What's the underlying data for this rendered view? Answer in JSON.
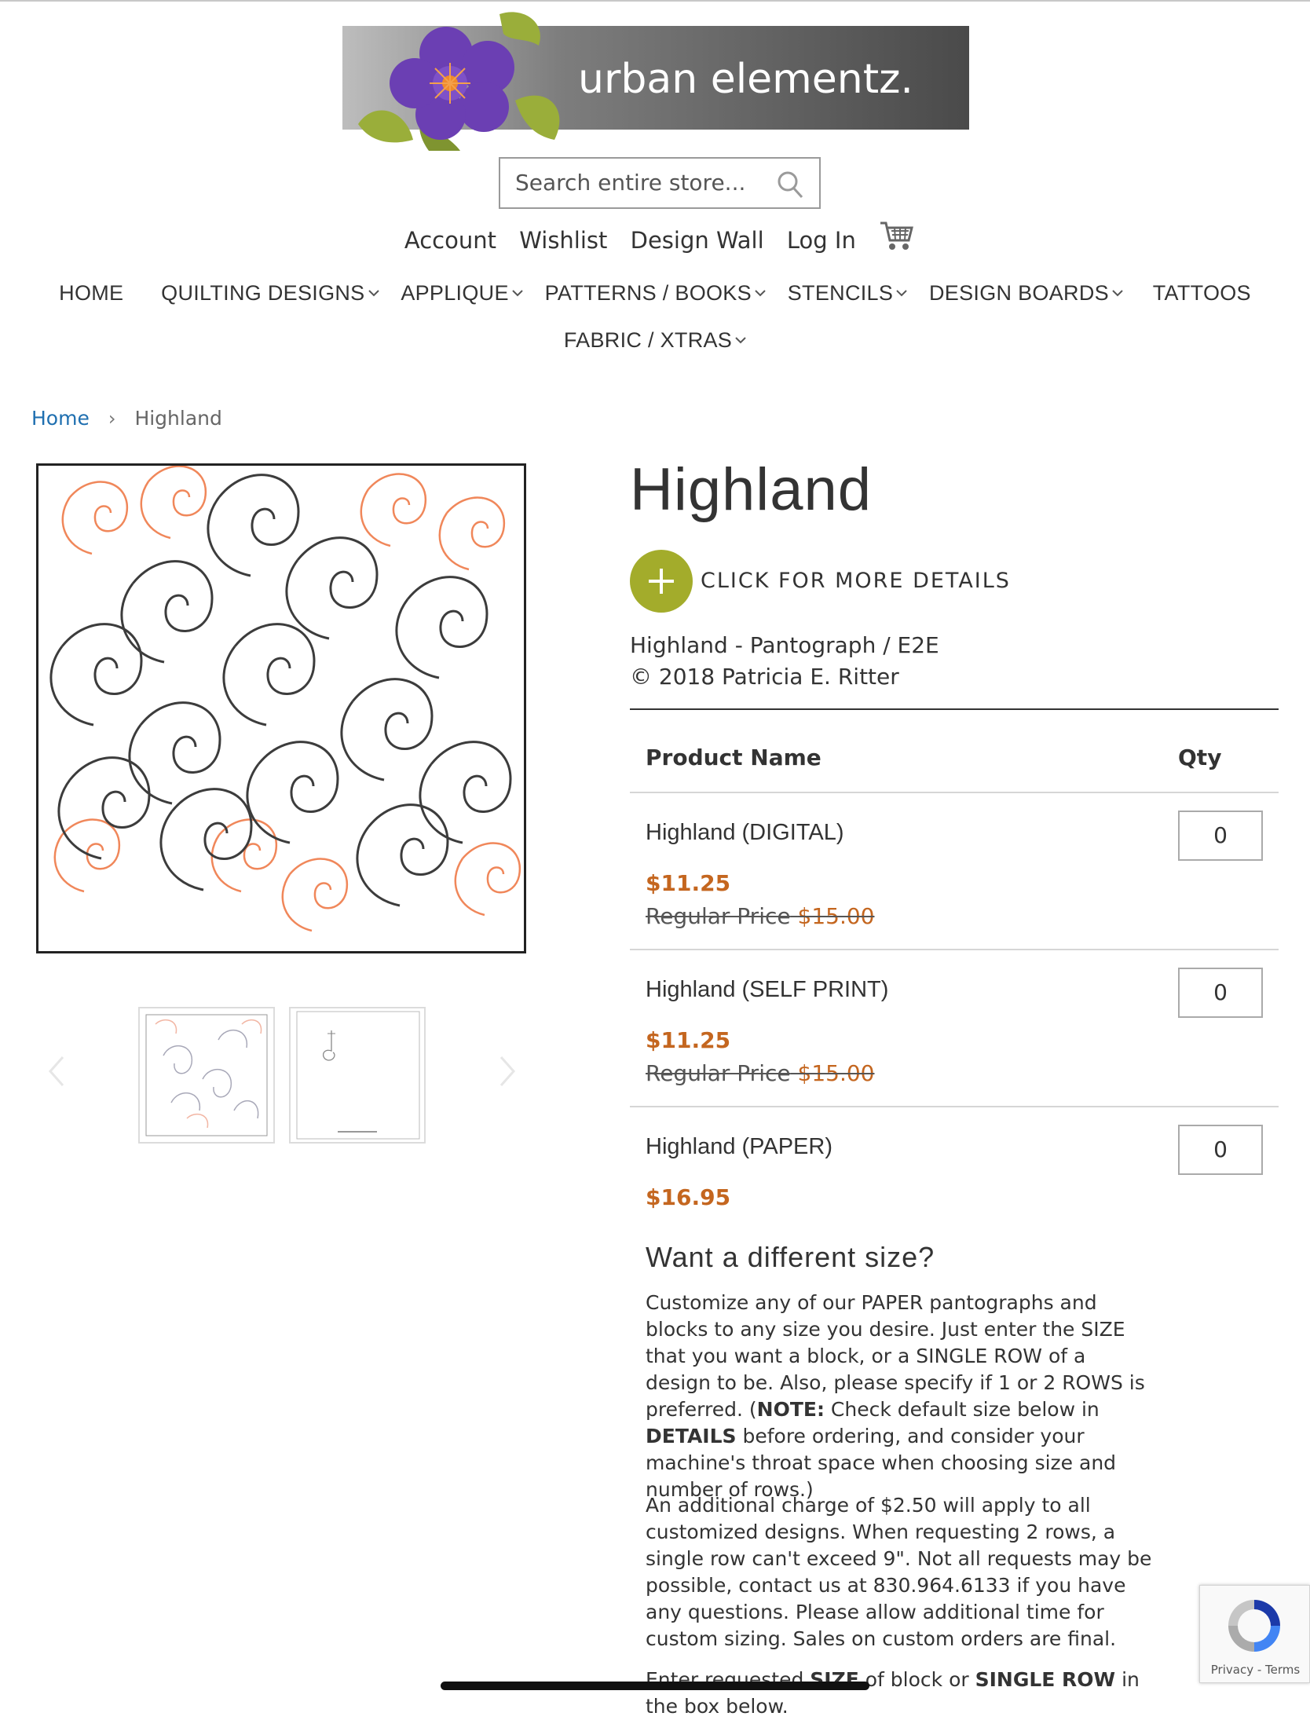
{
  "brand": {
    "logo_text": "urban elementz."
  },
  "search": {
    "placeholder": "Search entire store..."
  },
  "top_links": [
    "Account",
    "Wishlist",
    "Design Wall",
    "Log In"
  ],
  "nav": {
    "row1": [
      "HOME",
      "QUILTING DESIGNS",
      "APPLIQUE",
      "PATTERNS / BOOKS",
      "STENCILS",
      "DESIGN BOARDS",
      "TATTOOS"
    ],
    "row2": [
      "FABRIC / XTRAS"
    ]
  },
  "breadcrumb": {
    "home": "Home",
    "separator": "›",
    "current": "Highland"
  },
  "product": {
    "title": "Highland",
    "details_label": "CLICK FOR MORE DETAILS",
    "description_line1": "Highland - Pantograph / E2E",
    "description_line2": "© 2018 Patricia E. Ritter"
  },
  "table": {
    "header_name": "Product Name",
    "header_qty": "Qty",
    "rows": [
      {
        "name": "Highland (DIGITAL)",
        "price": "$11.25",
        "regular_label": "Regular Price",
        "regular_price": "$15.00",
        "qty": "0"
      },
      {
        "name": "Highland (SELF PRINT)",
        "price": "$11.25",
        "regular_label": "Regular Price",
        "regular_price": "$15.00",
        "qty": "0"
      },
      {
        "name": "Highland (PAPER)",
        "price": "$16.95",
        "qty": "0"
      }
    ]
  },
  "custom_size": {
    "heading": "Want a different size?",
    "p1_a": "Customize any of our PAPER pantographs and blocks to any size you desire. Just enter the SIZE that you want a block, or a SINGLE ROW of a design to be. Also, please specify if 1 or 2 ROWS is preferred. (",
    "p1_note": "NOTE:",
    "p1_b": " Check default size below in ",
    "p1_details": "DETAILS",
    "p1_c": " before ordering, and consider your machine's throat space when choosing size and number of rows.)",
    "p2": "An additional charge of $2.50 will apply to all customized designs. When requesting 2 rows, a single row can't exceed 9\". Not all requests may be possible, contact us at 830.964.6133 if you have any questions. Please allow additional time for custom sizing. Sales on custom orders are final.",
    "p3_a": "Enter requested ",
    "p3_size": "SIZE",
    "p3_b": " of block or ",
    "p3_row": "SINGLE ROW",
    "p3_c": " in the box below."
  },
  "recaptcha": {
    "privacy": "Privacy",
    "sep": " - ",
    "terms": "Terms"
  },
  "colors": {
    "price": "#c4661f",
    "accent_green": "#a3ac2b",
    "link_blue": "#1f6fb0"
  },
  "icons": [
    "search-icon",
    "cart-icon",
    "chevron-down-icon",
    "plus-icon",
    "chevron-left-icon",
    "chevron-right-icon",
    "recaptcha-icon"
  ]
}
